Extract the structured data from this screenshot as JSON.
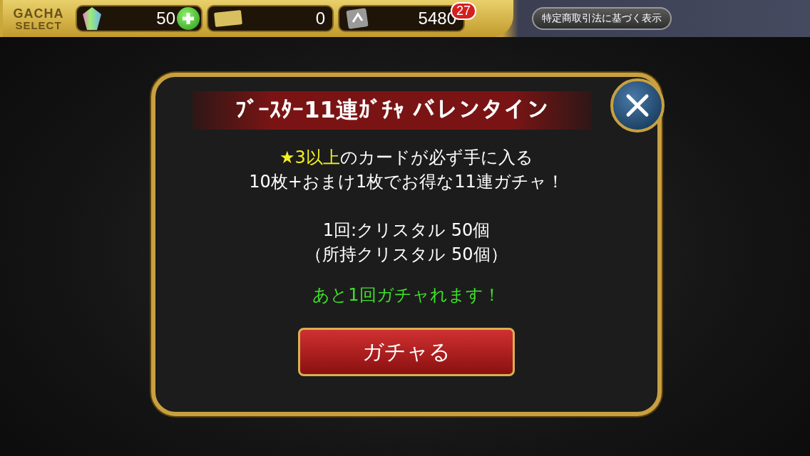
{
  "header": {
    "logo_line_1": "GACHA",
    "logo_line_2": "SELECT",
    "currencies": [
      {
        "kind": "crystal",
        "amount": "50",
        "add_button": true
      },
      {
        "kind": "ticket",
        "amount": "0",
        "add_button": false
      },
      {
        "kind": "card",
        "amount": "5480",
        "add_button": false,
        "badge": "27"
      }
    ],
    "legal_button": "特定商取引法に基づく表示"
  },
  "dialog": {
    "title": "ﾌﾞｰｽﾀｰ11連ｶﾞﾁｬ バレンタイン",
    "highlight": "★3以上",
    "line_1_rest": "のカードが必ず手に入る",
    "line_2": "10枚+おまけ1枚でお得な11連ガチャ！",
    "cost": "1回:クリスタル 50個",
    "owned": "（所持クリスタル 50個）",
    "notice": "あと1回ガチャれます！",
    "action_button": "ガチャる"
  }
}
